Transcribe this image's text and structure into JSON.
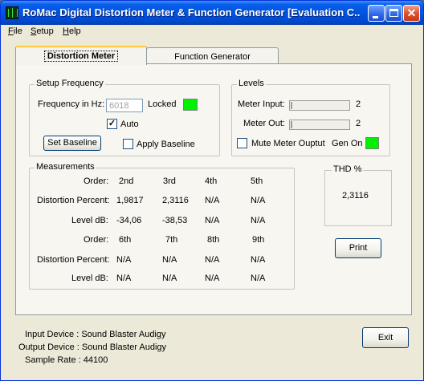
{
  "window": {
    "title": "RoMac Digital Distortion Meter & Function Generator [Evaluation C..."
  },
  "titlebar_buttons": {
    "close_glyph": "✕"
  },
  "menu": [
    {
      "underline": "F",
      "rest": "ile"
    },
    {
      "underline": "S",
      "rest": "etup"
    },
    {
      "underline": "H",
      "rest": "elp"
    }
  ],
  "tabs": [
    "Distortion Meter",
    "Function Generator"
  ],
  "setup_frequency": {
    "title": "Setup Frequency",
    "freq_label": "Frequency in Hz:",
    "freq_value": "6018",
    "locked_label": "Locked",
    "locked_color": "#00f200",
    "auto_label": "Auto",
    "auto_checked": "✓",
    "set_baseline": "Set Baseline",
    "apply_baseline": "Apply Baseline"
  },
  "levels": {
    "title": "Levels",
    "meter_input_label": "Meter Input:",
    "meter_input_value": "2",
    "meter_out_label": "Meter Out:",
    "meter_out_value": "2",
    "mute_label": "Mute Meter Ouptut",
    "gen_on_label": "Gen On",
    "gen_on_color": "#00f200"
  },
  "measurements": {
    "title": "Measurements",
    "row_labels": {
      "order": "Order:",
      "distortion": "Distortion Percent:",
      "level": "Level dB:"
    },
    "orders_1": [
      "2nd",
      "3rd",
      "4th",
      "5th"
    ],
    "distortion_1": [
      "1,9817",
      "2,3116",
      "N/A",
      "N/A"
    ],
    "level_1": [
      "-34,06",
      "-38,53",
      "N/A",
      "N/A"
    ],
    "orders_2": [
      "6th",
      "7th",
      "8th",
      "9th"
    ],
    "distortion_2": [
      "N/A",
      "N/A",
      "N/A",
      "N/A"
    ],
    "level_2": [
      "N/A",
      "N/A",
      "N/A",
      "N/A"
    ]
  },
  "thd": {
    "title": "THD %",
    "value": "2,3116"
  },
  "print_label": "Print",
  "exit_label": "Exit",
  "device_info": {
    "input": "Input Device : Sound Blaster Audigy",
    "output": "Output Device : Sound Blaster Audigy",
    "sample_rate": "Sample Rate : 44100"
  }
}
